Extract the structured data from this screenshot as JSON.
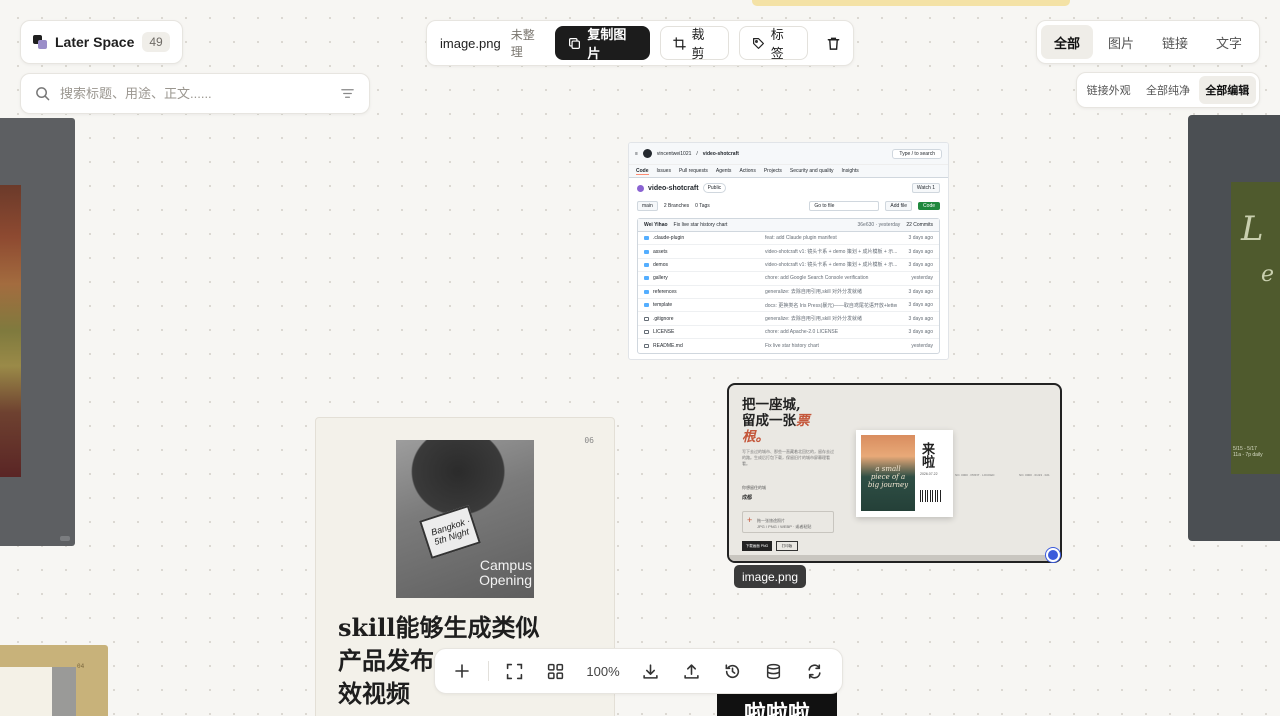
{
  "brand": {
    "name": "Later Space",
    "count": "49"
  },
  "search": {
    "placeholder": "搜索标题、用途、正文......"
  },
  "toolbar": {
    "filename": "image.png",
    "status": "未整理",
    "copy_label": "复制图片",
    "crop_label": "裁剪",
    "tag_label": "标签"
  },
  "filters": {
    "all": "全部",
    "image": "图片",
    "link": "链接",
    "text": "文字",
    "active": "全部"
  },
  "views": {
    "external": "链接外观",
    "pure": "全部纯净",
    "edit": "全部编辑",
    "active": "全部编辑"
  },
  "selection": {
    "tag": "image.png"
  },
  "dock": {
    "zoom": "100%"
  },
  "github_card": {
    "owner": "vincentwei1021",
    "repo": "video-shotcraft",
    "visibility": "Public",
    "search_hint": "Type / to search",
    "nav": [
      "Code",
      "Issues",
      "Pull requests",
      "Agents",
      "Actions",
      "Projects",
      "Security and quality",
      "Insights"
    ],
    "watch": "Watch 1",
    "branch": "main",
    "branches": "2 Branches",
    "tags": "0 Tags",
    "go_to_file": "Go to file",
    "add_file": "Add file",
    "code_btn": "Code",
    "commit_author": "Wei Yihao",
    "commit_msg": "Fix live star history chart",
    "commit_meta": "36e630 · yesterday",
    "commits": "22 Commits",
    "rows": [
      {
        "name": ".claude-plugin",
        "msg": "feat: add Claude plugin manifest",
        "time": "3 days ago",
        "dir": true
      },
      {
        "name": "assets",
        "msg": "video-shotcraft v1: 镜头卡系 + demo 策划 + 成片模板 + 示...",
        "time": "3 days ago",
        "dir": true
      },
      {
        "name": "demos",
        "msg": "video-shotcraft v1: 镜头卡系 + demo 策划 + 成片模板 + 示...",
        "time": "3 days ago",
        "dir": true
      },
      {
        "name": "gallery",
        "msg": "chore: add Google Search Console verification",
        "time": "yesterday",
        "dir": true
      },
      {
        "name": "references",
        "msg": "generalize: 去除自用引用,skill 对外分发就绪",
        "time": "3 days ago",
        "dir": true
      },
      {
        "name": "template",
        "msg": "docs: 更换类名 Iris Press(暴元)——取自鸢尾花语开放+letter...",
        "time": "3 days ago",
        "dir": true
      },
      {
        "name": ".gitignore",
        "msg": "generalize: 去除自用引用,skill 对外分发就绪",
        "time": "3 days ago",
        "dir": false
      },
      {
        "name": "LICENSE",
        "msg": "chore: add Apache-2.0 LICENSE",
        "time": "3 days ago",
        "dir": false
      },
      {
        "name": "README.md",
        "msg": "Fix live star history chart",
        "time": "yesterday",
        "dir": false
      }
    ]
  },
  "ticket_card": {
    "headline_1": "把一座城,",
    "headline_2": "留成一张",
    "headline_accent": "票",
    "headline_3": "根。",
    "desc": "写下去过的城市、那些一直藏着北回忆的，留存去过的路。生成后打包下载，保留旧片的城市屏幕理看看。",
    "label": "你想留住的城",
    "value": "成都",
    "drop_text": "拖一张旅途照片",
    "drop_hint": "JPG / PNG / WEBP · 或者粘贴",
    "btn_download": "下载画面 PNG",
    "btn_print": "打印版",
    "art_text": "a small piece of a big journey",
    "stub_text": "来啦",
    "stub_date": "2026.07.22",
    "codes_1": "NO. 0000 · PRINT · LOCKED",
    "codes_2": "NO. 0000 · 01/23 · 021"
  },
  "poster_card": {
    "number": "06",
    "photo_caption_1": "Campus",
    "photo_caption_2": "Opening",
    "screen_text": "Bangkok · 5th Night",
    "headline": "skill能够生成类似产品发布会质感的动效视频"
  },
  "right_card": {
    "script": "L",
    "script2": "e",
    "dates": "5/15 - 5/17",
    "dates2": "11a - 7p daily"
  },
  "bottom_left_card": {
    "number": "04"
  },
  "bottom_card": {
    "text": "啦啦啦"
  },
  "colors": {
    "accent": "#3b5bdb",
    "dark": "#1c1c1c",
    "ticket_accent": "#c4563a",
    "github_green": "#1f883d"
  }
}
